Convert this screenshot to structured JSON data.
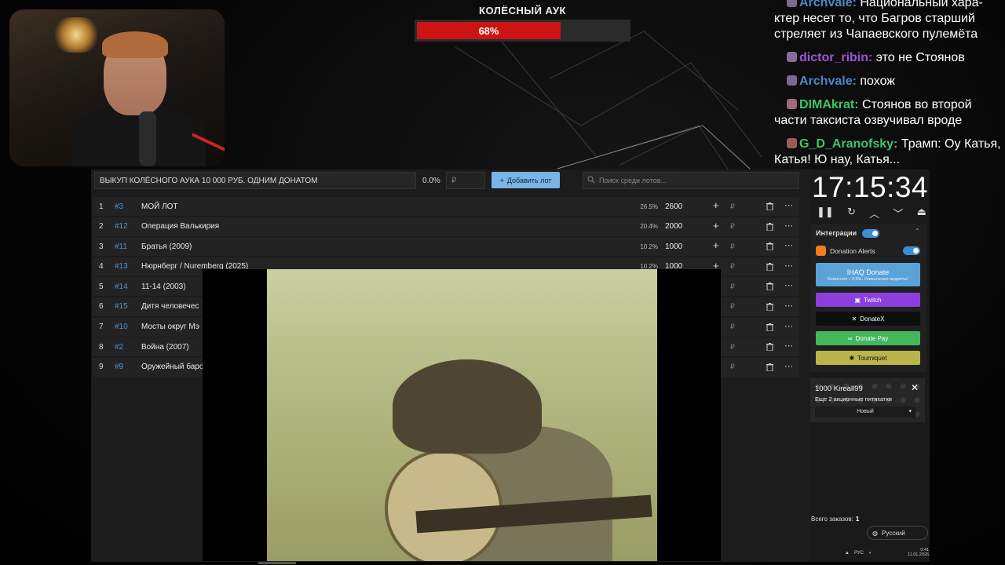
{
  "auk": {
    "title": "КОЛЁСНЫЙ АУК",
    "percent": "68%",
    "progress": 0.68,
    "fill_color": "#cc1414"
  },
  "chat": [
    {
      "nick": "Archvale:",
      "text": "Национальный хара-ктер несет то, что Багров старший стреляет из Чапаевского пулемёта",
      "nick_color": "#4f86c6",
      "badge_color": "#7a6a8e"
    },
    {
      "nick": "dictor_ribin:",
      "text": "это не Стоянов",
      "nick_color": "#a055d6",
      "badge_color": "#8a6a9a"
    },
    {
      "nick": "Archvale:",
      "text": "похож",
      "nick_color": "#4f86c6",
      "badge_color": "#7a6a8e"
    },
    {
      "nick": "DIMAkrat:",
      "text": "Стоянов во второй части таксиста озвучивал вроде",
      "nick_color": "#3ec46a",
      "badge_color": "#a06a7a"
    },
    {
      "nick": "G_D_Aranofsky:",
      "text": "Трамп: Оу Катья, Катья! Ю нау, Катья...",
      "nick_color": "#3ec46a",
      "badge_color": "#9a5a5a"
    }
  ],
  "toolbar": {
    "buyout_text": "ВЫКУП КОЛЁСНОГО АУКА 10 000 РУБ. ОДНИМ ДОНАТОМ",
    "percent": "0.0%",
    "currency_placeholder": "₽",
    "add_label": "Добавить лот",
    "search_placeholder": "Поиск среди лотов..."
  },
  "lots": [
    {
      "n": "1",
      "id": "#3",
      "name": "МОЙ ЛОТ",
      "pct": "26.5%",
      "amount": "2600"
    },
    {
      "n": "2",
      "id": "#12",
      "name": "Операция Валькирия",
      "pct": "20.4%",
      "amount": "2000"
    },
    {
      "n": "3",
      "id": "#11",
      "name": "Братья (2009)",
      "pct": "10.2%",
      "amount": "1000"
    },
    {
      "n": "4",
      "id": "#13",
      "name": "Нюрнберг / Nuremberg (2025)",
      "pct": "10.2%",
      "amount": "1000"
    },
    {
      "n": "5",
      "id": "#14",
      "name": "11-14 (2003)",
      "pct": "",
      "amount": ""
    },
    {
      "n": "6",
      "id": "#15",
      "name": "Дитя человечес",
      "pct": "",
      "amount": ""
    },
    {
      "n": "7",
      "id": "#10",
      "name": "Мосты округ Мэ",
      "pct": "",
      "amount": ""
    },
    {
      "n": "8",
      "id": "#2",
      "name": "Война (2007)",
      "pct": "",
      "amount": ""
    },
    {
      "n": "9",
      "id": "#9",
      "name": "Оружейный баро",
      "pct": "",
      "amount": ""
    }
  ],
  "currency": "₽",
  "timer": "17:15:34",
  "integrations": {
    "title": "Интеграции",
    "donation_alerts": "Donation Alerts",
    "ihaq_title": "IHAQ Donate",
    "ihaq_sub": "Комиссия – 3,5%. Уникальные виджеты!",
    "twitch": "Twitch",
    "donatex": "DonateX",
    "donatepay": "Donate Pay",
    "tourniquet": "Tourniquet"
  },
  "notification": {
    "title": "1000 Kireall99",
    "message": "Еще 2 акционные пятихатки",
    "select_value": "Новый"
  },
  "footer": {
    "orders_label": "Всего заказов:",
    "orders_count": "1",
    "language": "Русский"
  },
  "tray": {
    "lang": "РУС",
    "time": "0:41",
    "date": "11.01.2026"
  },
  "icons": [
    "trash-icon",
    "more-icon",
    "plus-icon",
    "search-icon",
    "pause-icon",
    "reset-icon",
    "chevron-up-icon",
    "chevron-down-icon",
    "eject-icon",
    "close-icon",
    "globe-icon"
  ]
}
